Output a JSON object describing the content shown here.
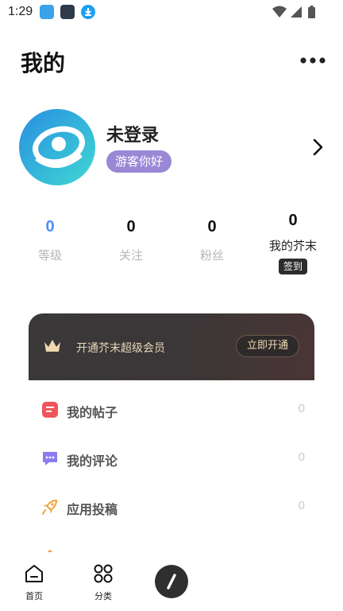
{
  "status_bar": {
    "time": "1:29",
    "icons": [
      "notification-app-icon",
      "notification-app-icon",
      "download-icon",
      "wifi-icon",
      "signal-icon",
      "battery-icon"
    ]
  },
  "header": {
    "title": "我的",
    "more_icon": "more-dots-icon"
  },
  "profile": {
    "username": "未登录",
    "badge": "游客你好",
    "arrow_icon": "chevron-right-icon"
  },
  "stats": [
    {
      "value": "0",
      "label": "等级",
      "color": "#4c8ef5"
    },
    {
      "value": "0",
      "label": "关注"
    },
    {
      "value": "0",
      "label": "粉丝"
    },
    {
      "value": "0",
      "label": "我的芥末",
      "action": "签到"
    }
  ],
  "vip": {
    "text": "开通芥末超级会员",
    "button": "立即开通",
    "icon": "crown-icon"
  },
  "menu": [
    {
      "label": "我的帖子",
      "count": "0",
      "icon": "post-icon",
      "color": "#f0555c"
    },
    {
      "label": "我的评论",
      "count": "0",
      "icon": "comment-icon",
      "color": "#8a7cf0"
    },
    {
      "label": "应用投稿",
      "count": "0",
      "icon": "rocket-icon",
      "color": "#f2a23a"
    }
  ],
  "bottom_nav": [
    {
      "label": "首页",
      "icon": "home-icon"
    },
    {
      "label": "分类",
      "icon": "category-grid-icon"
    }
  ],
  "compose_icon": "pen-icon",
  "colors": {
    "accent_blue": "#4c8ef5",
    "badge_purple": "#9a88d6",
    "vip_gold": "#e8d6b8"
  }
}
